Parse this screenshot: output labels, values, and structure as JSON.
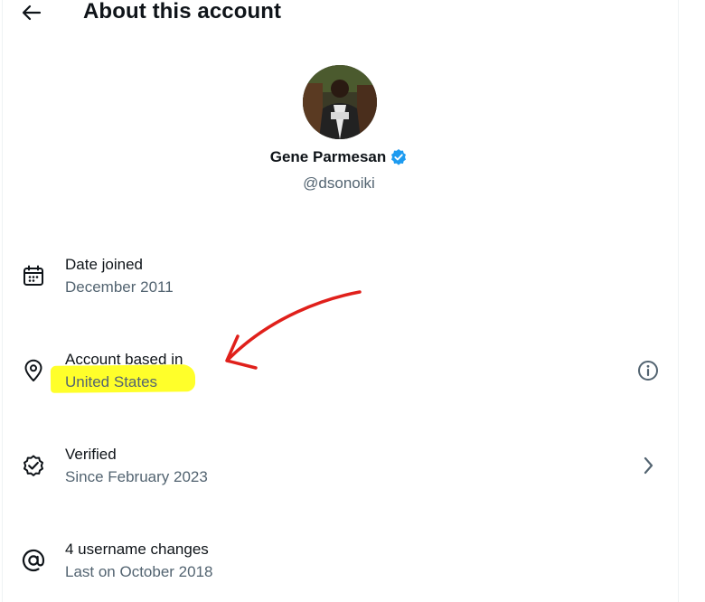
{
  "header": {
    "title": "About this account",
    "back_icon": "arrow-left-icon"
  },
  "profile": {
    "display_name": "Gene Parmesan",
    "handle": "@dsonoiki",
    "verified_badge_color": "#1d9bf0"
  },
  "rows": [
    {
      "icon": "calendar-icon",
      "title": "Date joined",
      "value": "December 2011",
      "trailing_icon": ""
    },
    {
      "icon": "location-pin-icon",
      "title": "Account based in",
      "value": "United States",
      "trailing_icon": "info-icon"
    },
    {
      "icon": "verified-check-icon",
      "title": "Verified",
      "value": "Since February 2023",
      "trailing_icon": "chevron-right-icon"
    },
    {
      "icon": "at-sign-icon",
      "title": "4 username changes",
      "value": "Last on October 2018",
      "trailing_icon": ""
    }
  ],
  "annotation": {
    "arrow_color": "#e0201b",
    "highlight_color": "#ffff2a"
  },
  "colors": {
    "primary_text": "#0f1419",
    "secondary_text": "#536471",
    "divider": "#eff3f4"
  }
}
